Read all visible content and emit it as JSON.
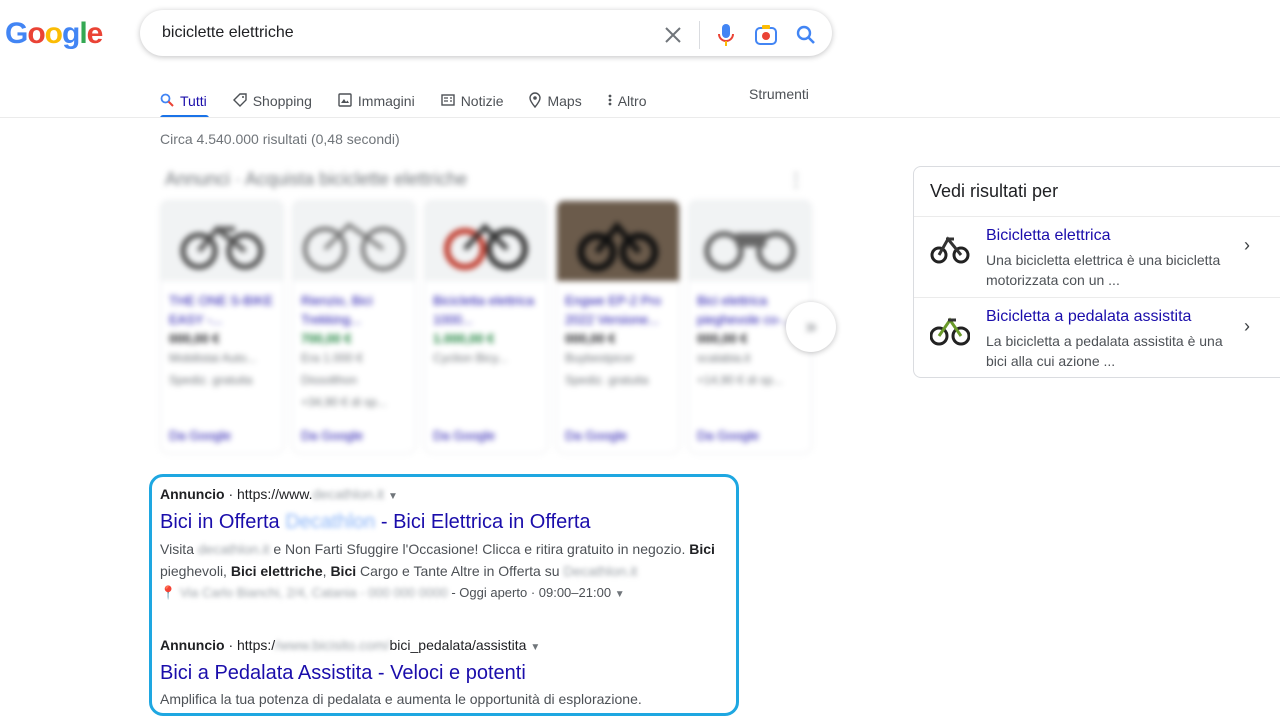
{
  "logo": {
    "text": "Google"
  },
  "search": {
    "query": "biciclette elettriche",
    "icons": [
      "clear-icon",
      "mic-icon",
      "camera-icon",
      "search-icon"
    ]
  },
  "tabs": [
    {
      "label": "Tutti",
      "icon": "search-icon",
      "active": true
    },
    {
      "label": "Shopping",
      "icon": "tag-icon"
    },
    {
      "label": "Immagini",
      "icon": "image-icon"
    },
    {
      "label": "Notizie",
      "icon": "news-icon"
    },
    {
      "label": "Maps",
      "icon": "pin-icon"
    },
    {
      "label": "Altro",
      "icon": "more-icon"
    }
  ],
  "tools_label": "Strumenti",
  "result_stats": "Circa 4.540.000 risultati (0,48 secondi)",
  "shopping": {
    "title": "Annunci · Acquista biciclette elettriche",
    "cards": [
      {
        "title": "THE ONE S-BIKE EASY -...",
        "price": "000,00 €",
        "seller": "Mobilistai Auto...",
        "shipping": "Spediz. gratuita",
        "footer": "Da Google"
      },
      {
        "title": "Rienzio, Bici Trekking...",
        "price": "700,00 €",
        "seller": "Era 1.000 €",
        "shipping": "Dissolthon",
        "extra": "+34,90 € di sp...",
        "footer": "Da Google"
      },
      {
        "title": "Bicicletta elettrica 1000...",
        "price": "1.000,00 €",
        "seller": "Cyclion Bicy...",
        "shipping": "",
        "footer": "Da Google"
      },
      {
        "title": "Engwe EP-2 Pro 2022 Versione...",
        "price": "000,00 €",
        "seller": "Buybestpicer",
        "shipping": "Spediz. gratuita",
        "footer": "Da Google"
      },
      {
        "title": "Bici elettrica pieghevole co-...",
        "price": "000,00 €",
        "seller": "scalabia.it",
        "shipping": "+14,90 € di sp...",
        "footer": "Da Google"
      }
    ]
  },
  "ads": [
    {
      "label": "Annuncio",
      "url_prefix": "https://www.",
      "url_blur": "decathlon.it",
      "url_suffix": "",
      "title_pre": "Bici in Offerta ",
      "title_blur": "Decathlon",
      "title_post": " - Bici Elettrica in Offerta",
      "desc1_pre": "Visita ",
      "desc1_blur": "decathlon.it",
      "desc1_post": " e Non Farti Sfuggire l'Occasione! Clicca e ritira gratuito in negozio. ",
      "desc1_bold": "Bici",
      "desc2_a": "pieghevoli, ",
      "desc2_b": "Bici elettriche",
      "desc2_c": ", ",
      "desc2_d": "Bici",
      "desc2_e": " Cargo e Tante Altre in Offerta su ",
      "desc2_blur": "Decathlon.it",
      "address_blur": "Via Carlo Bianchi, 2/4, Catania - 000 000 0000",
      "hours": "- Oggi aperto · 09:00–21:00"
    },
    {
      "label": "Annuncio",
      "url_prefix": "https:/",
      "url_blur": "/www.bicisito.com/",
      "url_suffix": "bici_pedalata/assistita",
      "title": "Bici a Pedalata Assistita - Veloci e potenti",
      "desc": "Amplifica la tua potenza di pedalata e aumenta le opportunità di esplorazione."
    }
  ],
  "panel": {
    "title": "Vedi risultati per",
    "items": [
      {
        "title": "Bicicletta elettrica",
        "desc": "Una bicicletta elettrica è una bicicletta motorizzata con un ..."
      },
      {
        "title": "Bicicletta a pedalata assistita",
        "desc": "La bicicletta a pedalata assistita è una bici alla cui azione ..."
      }
    ]
  },
  "colors": {
    "link": "#1a0dab",
    "accent": "#1a73e8",
    "ad_border": "#1ea7e1"
  }
}
